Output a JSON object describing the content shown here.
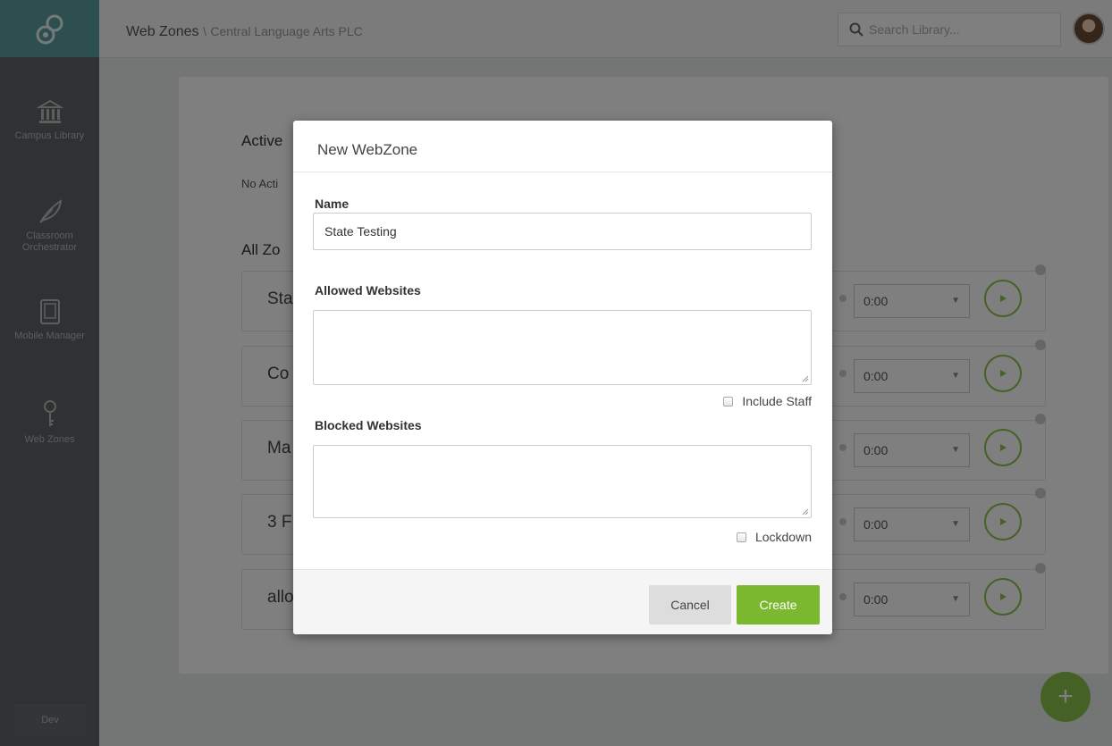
{
  "sidebar": {
    "items": [
      {
        "label": "Campus Library",
        "icon": "library-icon"
      },
      {
        "label": "Classroom Orchestrator",
        "icon": "feather-icon"
      },
      {
        "label": "Mobile Manager",
        "icon": "tablet-icon"
      },
      {
        "label": "Web Zones",
        "icon": "key-icon"
      }
    ],
    "footer_label": "Dev"
  },
  "topbar": {
    "breadcrumb_main": "Web Zones",
    "breadcrumb_separator": "\\",
    "breadcrumb_sub": "Central Language Arts PLC",
    "search_placeholder": "Search Library..."
  },
  "main": {
    "active_title": "Active",
    "no_active_text": "No Acti",
    "all_title": "All Zo",
    "zones": [
      {
        "name": "Sta",
        "duration": "0:00"
      },
      {
        "name": "Co",
        "duration": "0:00"
      },
      {
        "name": "Ma",
        "duration": "0:00"
      },
      {
        "name": "3 F",
        "duration": "0:00"
      },
      {
        "name": "allo",
        "duration": "0:00"
      }
    ]
  },
  "modal": {
    "title": "New WebZone",
    "name_label": "Name",
    "name_value": "State Testing",
    "allowed_label": "Allowed Websites",
    "allowed_value": "",
    "include_staff_label": "Include Staff",
    "blocked_label": "Blocked Websites",
    "blocked_value": "",
    "lockdown_label": "Lockdown",
    "cancel_label": "Cancel",
    "create_label": "Create"
  },
  "colors": {
    "accent_green": "#7cb82f",
    "sidebar": "#5e6466",
    "logo_teal": "#5b9fa1"
  }
}
